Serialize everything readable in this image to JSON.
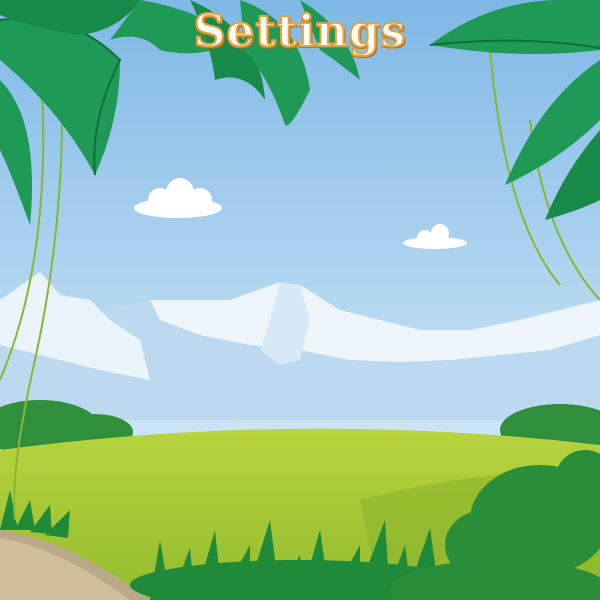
{
  "screen": {
    "title": "Settings"
  },
  "colors": {
    "sky_top": "#7fb8e6",
    "sky_bottom": "#d7ecf8",
    "mountain": "#e8f3fb",
    "mountain_shadow": "#b9d7ee",
    "meadow": "#a9c93a",
    "meadow_dark": "#86b02c",
    "bush": "#2f8f3c",
    "leaf": "#1f9a56",
    "leaf_dark": "#0f6e3a",
    "vine": "#7db02e",
    "path": "#c7b48f",
    "title_fill": "#ffffff",
    "title_outline": "#e6a23a"
  },
  "icons": {
    "clouds": "cloud-icon",
    "palm_leaves": "palm-leaf-icon"
  }
}
